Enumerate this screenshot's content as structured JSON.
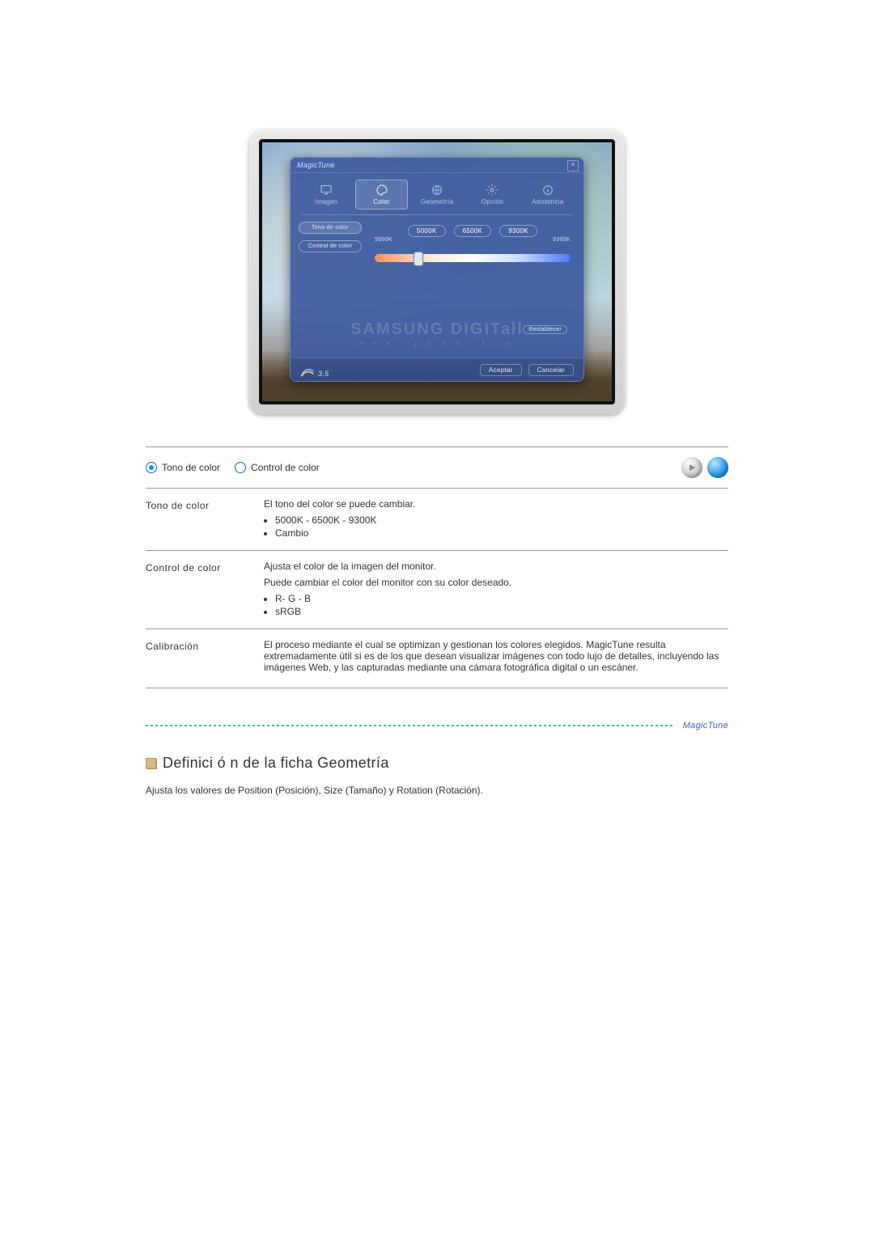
{
  "osd": {
    "title": "MagicTune",
    "tabs": [
      "Imagen",
      "Color",
      "Geometría",
      "Opción",
      "Asistencia"
    ],
    "active_tab": 1,
    "side_buttons": [
      "Tono de color",
      "Control de color"
    ],
    "temp_buttons": [
      "5000K",
      "6500K",
      "9300K"
    ],
    "scale_left": "5000K",
    "scale_right": "9300K",
    "brand": "SAMSUNG DIGITall",
    "brand_sub": "e v e r y o n e ' s   i n",
    "reset": "Restablecer",
    "logo_text": "MagicTune",
    "logo_ver": "3.5",
    "ok": "Aceptar",
    "cancel": "Cancelar"
  },
  "radios": {
    "opt1": "Tono de color",
    "opt2": "Control de color"
  },
  "rows": {
    "tone": {
      "label": "Tono de color",
      "desc": "El tono del color se puede cambiar.",
      "i1": "5000K - 6500K - 9300K",
      "i2": "Cambio"
    },
    "control": {
      "label": "Control de color",
      "d1": "Ajusta el color de la imagen del monitor.",
      "d2": "Puede cambiar el color del monitor con su color deseado.",
      "i1": "R- G - B",
      "i2": "sRGB"
    },
    "calib": {
      "label": "Calibración",
      "desc": "El proceso mediante el cual se optimizan y gestionan los colores elegidos. MagicTune resulta extremadamente útil si es de los que desean visualizar imágenes con todo lujo de detalles, incluyendo las imágenes Web, y las capturadas mediante una cámara fotográfica digital o un escáner."
    }
  },
  "divider_logo": "MagicTune",
  "geom": {
    "title": "Definici ó n de la ficha Geometría",
    "desc": "Ajusta los valores de Position (Posición), Size (Tamaño) y Rotation (Rotación)."
  }
}
